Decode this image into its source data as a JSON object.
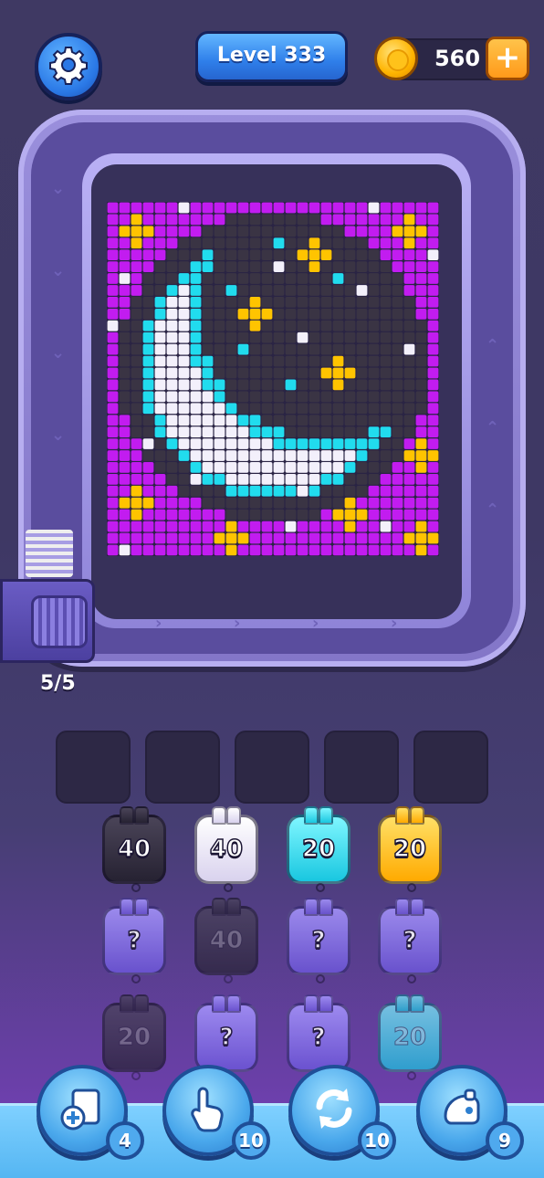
{
  "header": {
    "level_label": "Level 333",
    "coins": "560",
    "add_coins_label": "+"
  },
  "conveyor": {
    "queue_count": "5/5"
  },
  "pieces": [
    {
      "row": 1,
      "col": 1,
      "color": "black",
      "label": "40",
      "hidden": false
    },
    {
      "row": 1,
      "col": 2,
      "color": "white",
      "label": "40",
      "hidden": false
    },
    {
      "row": 1,
      "col": 3,
      "color": "cyan",
      "label": "20",
      "hidden": false
    },
    {
      "row": 1,
      "col": 4,
      "color": "gold",
      "label": "20",
      "hidden": false
    },
    {
      "row": 2,
      "col": 1,
      "color": "mystery",
      "label": "?",
      "hidden": true
    },
    {
      "row": 2,
      "col": 2,
      "color": "black",
      "label": "40",
      "hidden": false
    },
    {
      "row": 2,
      "col": 3,
      "color": "mystery",
      "label": "?",
      "hidden": true
    },
    {
      "row": 2,
      "col": 4,
      "color": "mystery",
      "label": "?",
      "hidden": true
    },
    {
      "row": 3,
      "col": 1,
      "color": "black",
      "label": "20",
      "hidden": false
    },
    {
      "row": 3,
      "col": 2,
      "color": "mystery",
      "label": "?",
      "hidden": true
    },
    {
      "row": 3,
      "col": 3,
      "color": "mystery",
      "label": "?",
      "hidden": true
    },
    {
      "row": 3,
      "col": 4,
      "color": "cyan",
      "label": "20",
      "hidden": false
    }
  ],
  "boosters": [
    {
      "name": "add-slot",
      "count": "4"
    },
    {
      "name": "tap",
      "count": "10"
    },
    {
      "name": "shuffle",
      "count": "10"
    },
    {
      "name": "vacuum",
      "count": "9"
    }
  ],
  "palette": {
    "purple": "#c21cf0",
    "black": "#3a3444",
    "white": "#f3f0fb",
    "cyan": "#21dcee",
    "gold": "#ffc400"
  }
}
